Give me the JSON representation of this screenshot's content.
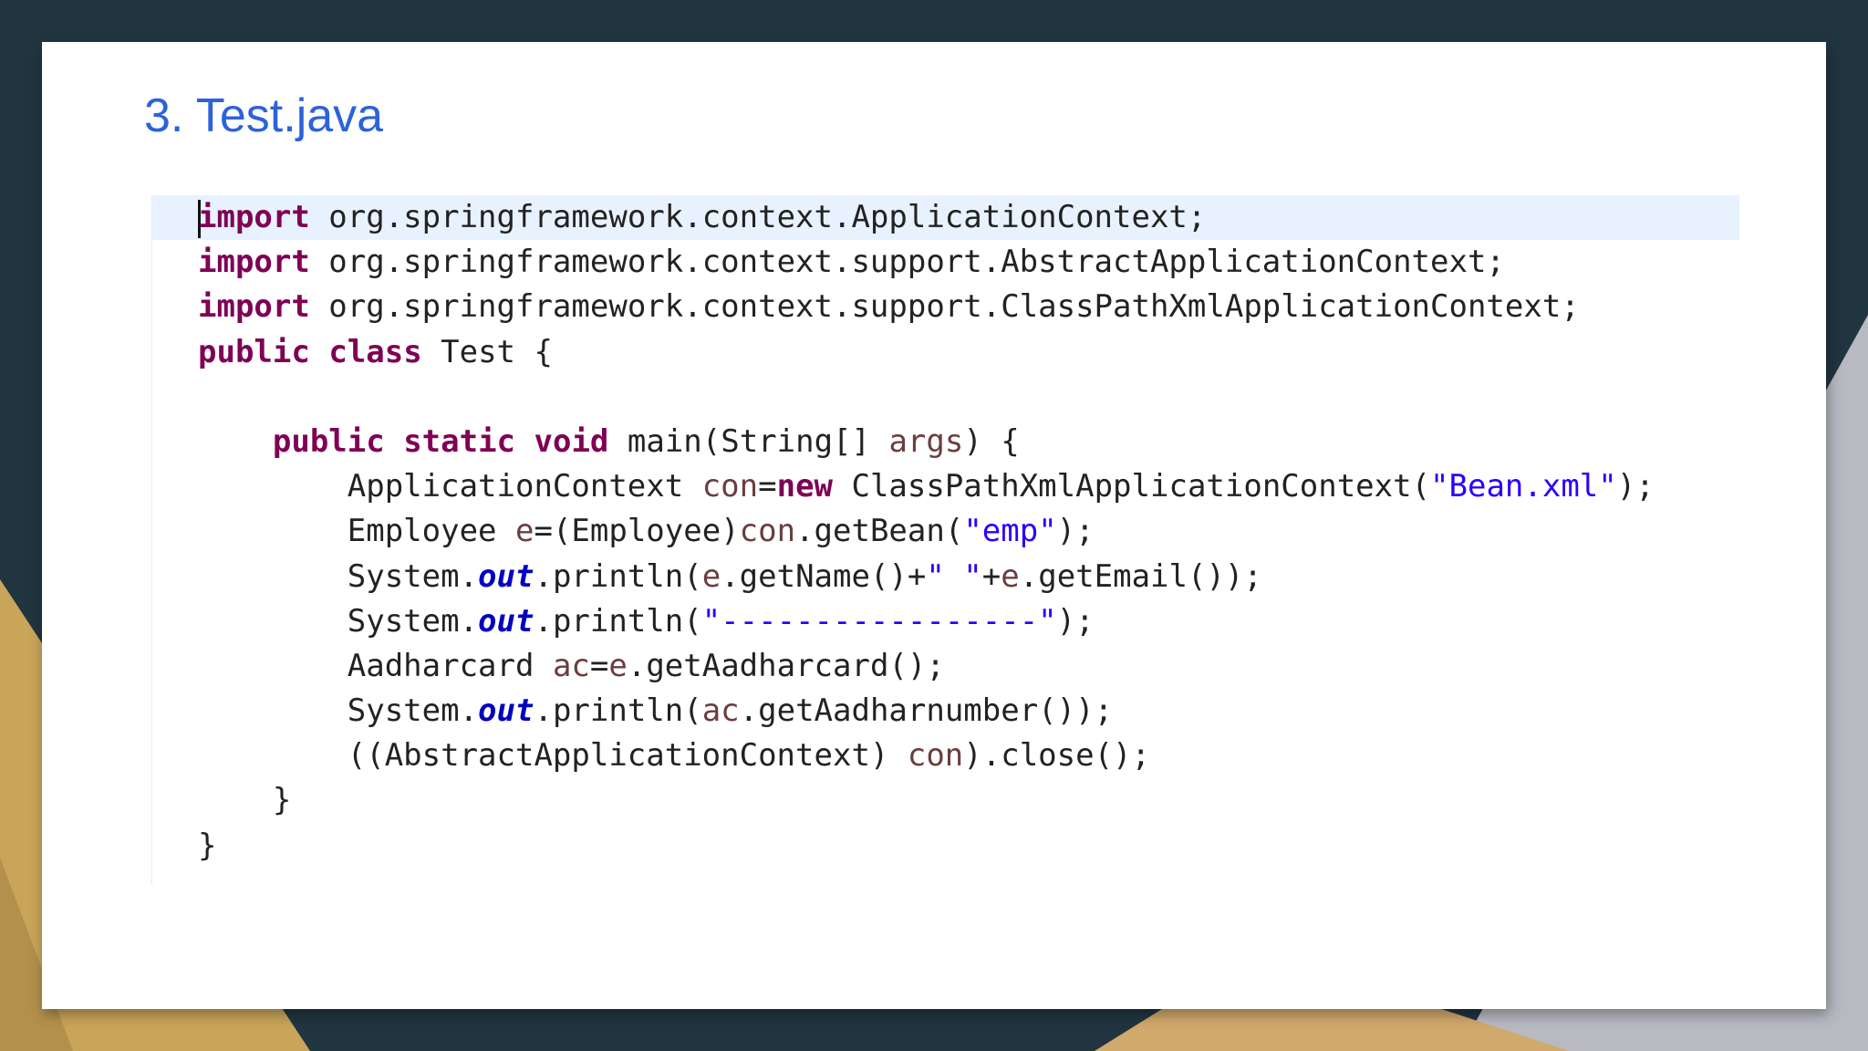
{
  "slide": {
    "title": "3. Test.java"
  },
  "colors": {
    "background": "#213540",
    "accent_gold": "#c9a55a",
    "slide": "#ffffff",
    "title": "#2d62d9",
    "keyword": "#7f0055",
    "string": "#2a00ff",
    "field": "#0000c0",
    "local_variable": "#6a3e3e",
    "current_line_highlight": "#e8f2fe"
  },
  "code": {
    "language": "java",
    "lines": [
      [
        {
          "t": "kw",
          "v": "import"
        },
        {
          "t": "plain",
          "v": " org.springframework.context.ApplicationContext;"
        }
      ],
      [
        {
          "t": "kw",
          "v": "import"
        },
        {
          "t": "plain",
          "v": " org.springframework.context.support.AbstractApplicationContext;"
        }
      ],
      [
        {
          "t": "kw",
          "v": "import"
        },
        {
          "t": "plain",
          "v": " org.springframework.context.support.ClassPathXmlApplicationContext;"
        }
      ],
      [
        {
          "t": "kw",
          "v": "public"
        },
        {
          "t": "plain",
          "v": " "
        },
        {
          "t": "kw",
          "v": "class"
        },
        {
          "t": "plain",
          "v": " Test {"
        }
      ],
      [],
      [
        {
          "t": "plain",
          "v": "    "
        },
        {
          "t": "kw",
          "v": "public"
        },
        {
          "t": "plain",
          "v": " "
        },
        {
          "t": "kw",
          "v": "static"
        },
        {
          "t": "plain",
          "v": " "
        },
        {
          "t": "kw",
          "v": "void"
        },
        {
          "t": "plain",
          "v": " main(String[] "
        },
        {
          "t": "var",
          "v": "args"
        },
        {
          "t": "plain",
          "v": ") {"
        }
      ],
      [
        {
          "t": "plain",
          "v": "        ApplicationContext "
        },
        {
          "t": "var",
          "v": "con"
        },
        {
          "t": "plain",
          "v": "="
        },
        {
          "t": "kw",
          "v": "new"
        },
        {
          "t": "plain",
          "v": " ClassPathXmlApplicationContext("
        },
        {
          "t": "str",
          "v": "\"Bean.xml\""
        },
        {
          "t": "plain",
          "v": ");"
        }
      ],
      [
        {
          "t": "plain",
          "v": "        Employee "
        },
        {
          "t": "var",
          "v": "e"
        },
        {
          "t": "plain",
          "v": "=(Employee)"
        },
        {
          "t": "var",
          "v": "con"
        },
        {
          "t": "plain",
          "v": ".getBean("
        },
        {
          "t": "str",
          "v": "\"emp\""
        },
        {
          "t": "plain",
          "v": ");"
        }
      ],
      [
        {
          "t": "plain",
          "v": "        System."
        },
        {
          "t": "field",
          "v": "out"
        },
        {
          "t": "plain",
          "v": ".println("
        },
        {
          "t": "var",
          "v": "e"
        },
        {
          "t": "plain",
          "v": ".getName()+"
        },
        {
          "t": "str",
          "v": "\" \""
        },
        {
          "t": "plain",
          "v": "+"
        },
        {
          "t": "var",
          "v": "e"
        },
        {
          "t": "plain",
          "v": ".getEmail());"
        }
      ],
      [
        {
          "t": "plain",
          "v": "        System."
        },
        {
          "t": "field",
          "v": "out"
        },
        {
          "t": "plain",
          "v": ".println("
        },
        {
          "t": "str",
          "v": "\"-----------------\""
        },
        {
          "t": "plain",
          "v": ");"
        }
      ],
      [
        {
          "t": "plain",
          "v": "        Aadharcard "
        },
        {
          "t": "var",
          "v": "ac"
        },
        {
          "t": "plain",
          "v": "="
        },
        {
          "t": "var",
          "v": "e"
        },
        {
          "t": "plain",
          "v": ".getAadharcard();"
        }
      ],
      [
        {
          "t": "plain",
          "v": "        System."
        },
        {
          "t": "field",
          "v": "out"
        },
        {
          "t": "plain",
          "v": ".println("
        },
        {
          "t": "var",
          "v": "ac"
        },
        {
          "t": "plain",
          "v": ".getAadharnumber());"
        }
      ],
      [
        {
          "t": "plain",
          "v": "        ((AbstractApplicationContext) "
        },
        {
          "t": "var",
          "v": "con"
        },
        {
          "t": "plain",
          "v": ").close();"
        }
      ],
      [
        {
          "t": "plain",
          "v": "    }"
        }
      ],
      [
        {
          "t": "plain",
          "v": "}"
        }
      ]
    ]
  }
}
